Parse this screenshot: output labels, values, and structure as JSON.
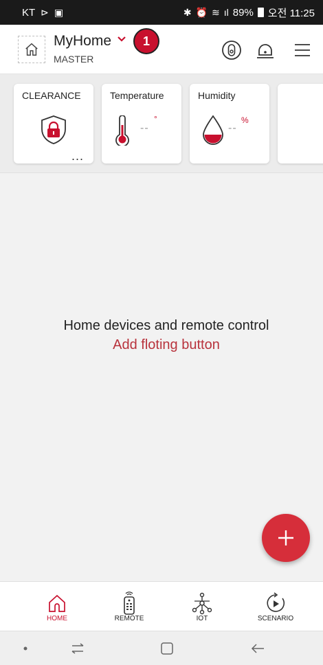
{
  "status_bar": {
    "carrier": "KT",
    "battery": "89%",
    "time": "오전 11:25"
  },
  "header": {
    "home_name": "MyHome",
    "role": "MASTER",
    "badge": "1"
  },
  "cards": [
    {
      "title": "CLEARANCE",
      "icon": "lock-shield-icon",
      "more": "..."
    },
    {
      "title": "Temperature",
      "icon": "thermometer-icon",
      "value": "--",
      "unit": "°"
    },
    {
      "title": "Humidity",
      "icon": "water-drop-icon",
      "value": "--",
      "unit": "%"
    }
  ],
  "empty_state": {
    "title": "Home devices and remote control",
    "subtitle": "Add floting button"
  },
  "bottom_nav": [
    {
      "label": "HOME",
      "icon": "home-icon",
      "active": true
    },
    {
      "label": "REMOTE",
      "icon": "remote-control-icon",
      "active": false
    },
    {
      "label": "IOT",
      "icon": "iot-network-icon",
      "active": false
    },
    {
      "label": "SCENARIO",
      "icon": "scenario-play-icon",
      "active": false
    }
  ],
  "colors": {
    "accent": "#c8102e",
    "fab": "#d62e3a",
    "subtitle": "#b8323c"
  }
}
